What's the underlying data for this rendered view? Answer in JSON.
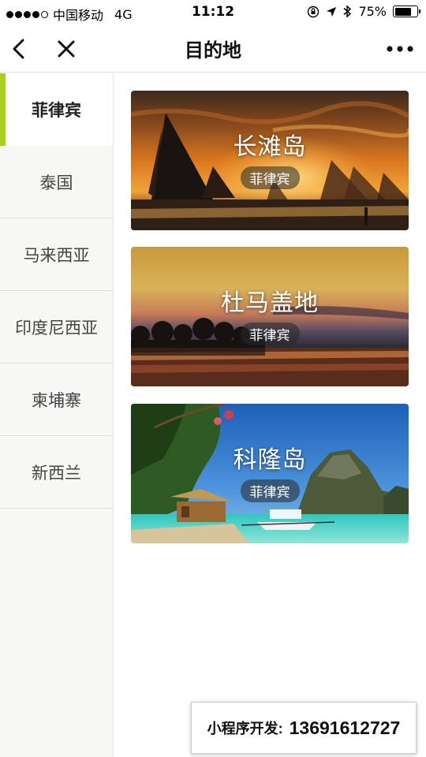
{
  "status_bar": {
    "carrier": "中国移动",
    "network": "4G",
    "time": "11:12",
    "battery": "75%",
    "battery_level": 0.75
  },
  "navbar": {
    "title": "目的地",
    "back_icon": "chevron-left-icon",
    "close_icon": "close-icon",
    "more_icon": "more-dots-icon"
  },
  "sidebar": {
    "accent_color": "#a8d21b",
    "items": [
      {
        "label": "菲律宾",
        "active": true
      },
      {
        "label": "泰国",
        "active": false
      },
      {
        "label": "马来西亚",
        "active": false
      },
      {
        "label": "印度尼西亚",
        "active": false
      },
      {
        "label": "柬埔寨",
        "active": false
      },
      {
        "label": "新西兰",
        "active": false
      }
    ]
  },
  "destinations": [
    {
      "name": "长滩岛",
      "country": "菲律宾",
      "scene": "sunset sailboats on beach"
    },
    {
      "name": "杜马盖地",
      "country": "菲律宾",
      "scene": "sunset over calm water with tree silhouettes"
    },
    {
      "name": "科隆岛",
      "country": "菲律宾",
      "scene": "turquoise lagoon with limestone cliffs and hut"
    }
  ],
  "promo": {
    "label": "小程序开发:",
    "phone": "13691612727"
  }
}
